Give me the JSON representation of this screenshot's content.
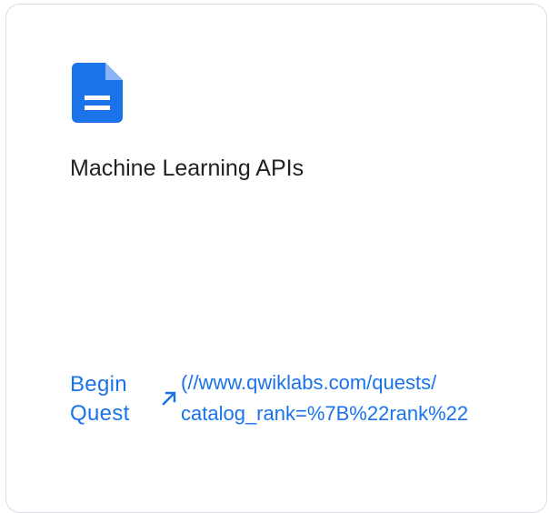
{
  "card": {
    "icon": "document-icon",
    "title": "Machine Learning APIs",
    "cta": {
      "label_line1": "Begin",
      "label_line2": "Quest",
      "icon": "external-link-arrow-icon",
      "url_line1": "(//www.qwiklabs.com/quests/",
      "url_line2": "catalog_rank=%7B%22rank%22"
    }
  },
  "colors": {
    "accent": "#1a73e8",
    "title_text": "#202124",
    "border": "#dadce0"
  }
}
